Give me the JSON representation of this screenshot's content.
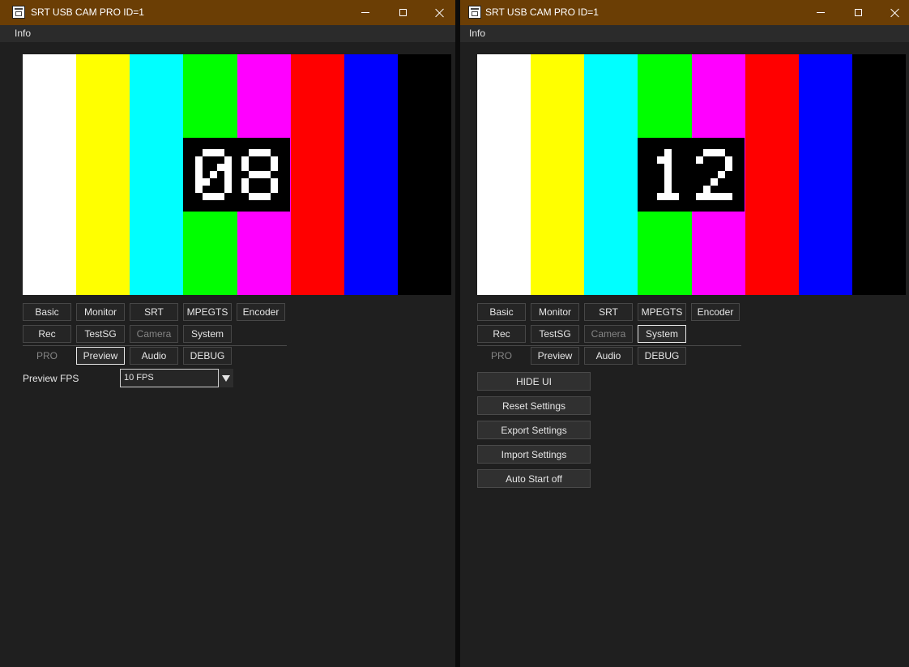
{
  "windows": [
    {
      "title": "SRT USB CAM PRO ID=1",
      "menu": [
        "Info"
      ],
      "preview": {
        "bars": [
          "#ffffff",
          "#ffff00",
          "#00ffff",
          "#00ff00",
          "#ff00ff",
          "#ff0000",
          "#0000ff",
          "#000000"
        ],
        "counter": "08"
      },
      "tabs": [
        [
          "Basic",
          "Monitor",
          "SRT",
          "MPEGTS",
          "Encoder"
        ],
        [
          "Rec",
          "TestSG",
          "Camera",
          "System"
        ],
        [
          "PRO",
          "Preview",
          "Audio",
          "DEBUG"
        ]
      ],
      "active_tab": "Preview",
      "settings": {
        "preview_fps_label": "Preview FPS",
        "preview_fps_value": "10 FPS"
      }
    },
    {
      "title": "SRT USB CAM PRO ID=1",
      "menu": [
        "Info"
      ],
      "preview": {
        "bars": [
          "#ffffff",
          "#ffff00",
          "#00ffff",
          "#00ff00",
          "#ff00ff",
          "#ff0000",
          "#0000ff",
          "#000000"
        ],
        "counter": "12"
      },
      "tabs": [
        [
          "Basic",
          "Monitor",
          "SRT",
          "MPEGTS",
          "Encoder"
        ],
        [
          "Rec",
          "TestSG",
          "Camera",
          "System"
        ],
        [
          "PRO",
          "Preview",
          "Audio",
          "DEBUG"
        ]
      ],
      "active_tab": "System",
      "system_buttons": [
        "HIDE UI",
        "Reset Settings",
        "Export Settings",
        "Import Settings",
        "Auto Start off"
      ]
    }
  ],
  "colors": {
    "titlebar": "#6b3e05",
    "window_bg": "#1f1f1f",
    "menubar": "#2b2b2b",
    "disabled_text": "#858585"
  }
}
